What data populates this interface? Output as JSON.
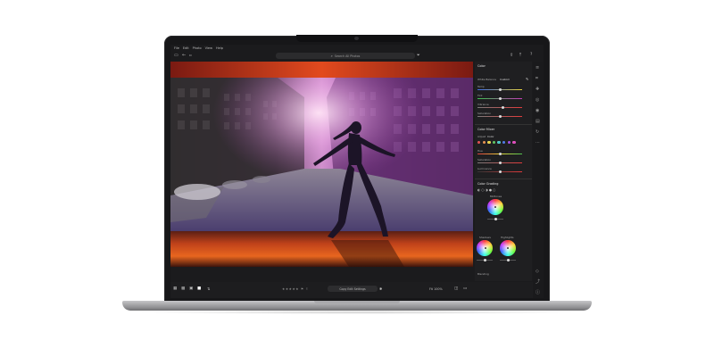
{
  "menu": [
    "File",
    "Edit",
    "Photo",
    "View",
    "Help"
  ],
  "search": {
    "placeholder": "Search All Photos"
  },
  "panel": {
    "color": {
      "title": "Color",
      "wb_label": "White Balance",
      "wb_value": "Custom",
      "sliders": [
        {
          "label": "Temp",
          "value": "",
          "pos": 0.5
        },
        {
          "label": "Tint",
          "value": "",
          "pos": 0.5
        },
        {
          "label": "Vibrance",
          "value": "",
          "pos": 0.55
        },
        {
          "label": "Saturation",
          "value": "",
          "pos": 0.5
        }
      ]
    },
    "mixer": {
      "title": "Color Mixer",
      "adjust_label": "Adjust",
      "adjust_value": "Color",
      "swatch_colors": [
        "#e03b3b",
        "#e8853b",
        "#e8d23b",
        "#4fc24f",
        "#3bc7c7",
        "#3b6be8",
        "#9a3be8",
        "#e03bb8"
      ],
      "sliders": [
        {
          "label": "Hue",
          "pos": 0.5
        },
        {
          "label": "Saturation",
          "pos": 0.5
        },
        {
          "label": "Luminance",
          "pos": 0.5
        }
      ]
    },
    "grading": {
      "title": "Color Grading",
      "wheels": [
        {
          "label": "Midtones"
        },
        {
          "label": "Shadows"
        },
        {
          "label": "Highlights"
        }
      ],
      "blending_label": "Blending"
    }
  },
  "bottom": {
    "copy_button": "Copy Edit Settings",
    "fit_label": "Fit",
    "zoom_value": "100%"
  },
  "icons": {
    "back": "arrow-left-icon",
    "filter": "filter-icon",
    "upload": "cloud-upload-icon",
    "help": "help-icon",
    "stars": "star-rating-icons"
  }
}
